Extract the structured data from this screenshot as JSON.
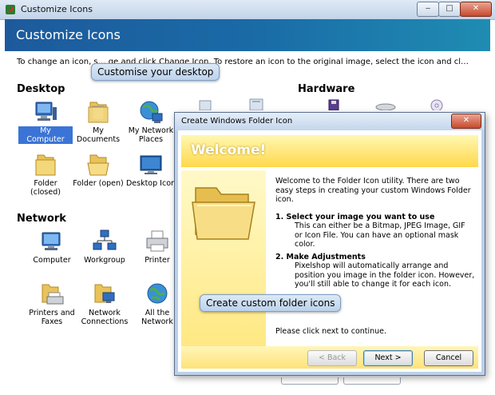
{
  "window": {
    "title": "Customize Icons",
    "minimize_glyph": "‒",
    "maximize_glyph": "□",
    "close_glyph": "✕"
  },
  "header": {
    "title": "Customize Icons"
  },
  "instructions": "To change an icon, s… ge and click Change Icon. To restore an icon to the original image, select the icon and cl…",
  "callouts": {
    "desktop": "Customise your desktop",
    "folder": "Create custom folder icons"
  },
  "sections": {
    "desktop": {
      "title": "Desktop",
      "items": [
        {
          "label": "My Computer",
          "icon": "computer-icon",
          "selected": true
        },
        {
          "label": "My\nDocuments",
          "icon": "folder-icon"
        },
        {
          "label": "My Network\nPlaces",
          "icon": "network-places-icon"
        },
        {
          "label": "Folder\n(closed)",
          "icon": "folder-icon"
        },
        {
          "label": "Folder (open)",
          "icon": "folder-open-icon"
        },
        {
          "label": "Desktop Icon",
          "icon": "desktop-icon"
        }
      ]
    },
    "network": {
      "title": "Network",
      "items": [
        {
          "label": "Computer",
          "icon": "computer-icon"
        },
        {
          "label": "Workgroup",
          "icon": "workgroup-icon"
        },
        {
          "label": "Printer",
          "icon": "printer-icon"
        },
        {
          "label": "Printers and\nFaxes",
          "icon": "printers-faxes-icon"
        },
        {
          "label": "Network\nConnections",
          "icon": "network-connections-icon"
        },
        {
          "label": "All the\nNetwork",
          "icon": "globe-icon"
        }
      ]
    },
    "hardware": {
      "title": "Hardware"
    }
  },
  "dialog": {
    "title": "Create Windows Folder Icon",
    "close_glyph": "✕",
    "welcome": "Welcome!",
    "intro": "Welcome to the Folder Icon utility.  There are two easy steps in creating your custom Windows Folder icon.",
    "steps": [
      {
        "heading": "1.  Select your image you want to use",
        "body": "This can either be a Bitmap, JPEG Image, GIF or Icon File.  You can have an optional mask color."
      },
      {
        "heading": "2.  Make Adjustments",
        "body": "Pixelshop will automatically arrange and position you image in the folder icon. However, you'll still able to change it for each icon."
      }
    ],
    "continue_text": "Please click next to continue.",
    "buttons": {
      "back": "< Back",
      "next": "Next >",
      "cancel": "Cancel"
    }
  },
  "colors": {
    "header_band": "#1d5a9c",
    "selection": "#3b74d6",
    "welcome_band": "#ffd84a"
  }
}
